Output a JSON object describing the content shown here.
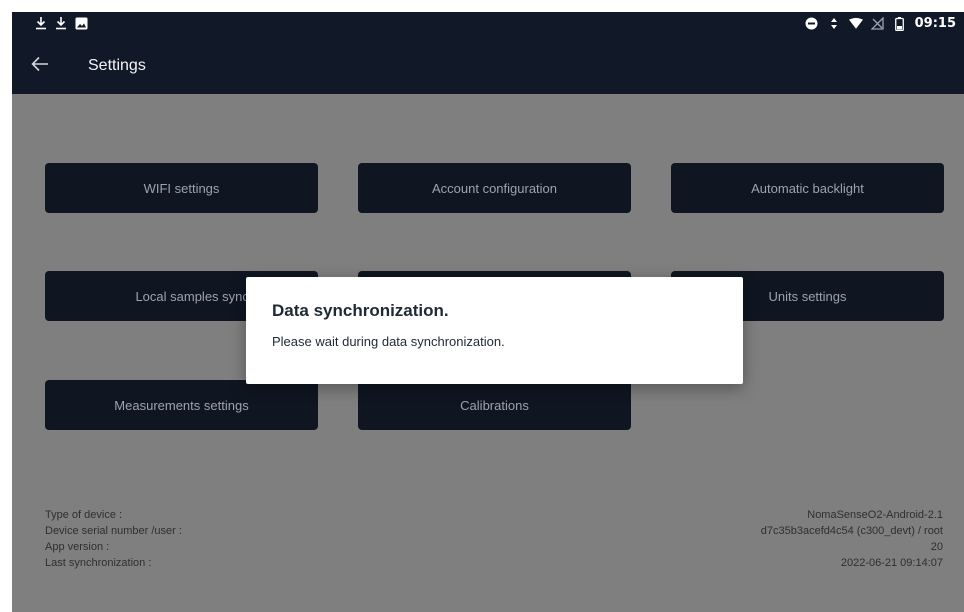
{
  "status_bar": {
    "left_icons": [
      "download-icon",
      "download-icon",
      "image-icon"
    ],
    "right_icons": [
      "do-not-disturb-icon",
      "data-arrows-icon",
      "wifi-icon",
      "no-signal-icon",
      "battery-icon"
    ],
    "time": "09:15"
  },
  "app_bar": {
    "title": "Settings",
    "back_icon": "arrow-left-icon"
  },
  "buttons": {
    "wifi": "WIFI settings",
    "account": "Account configuration",
    "backlight": "Automatic backlight",
    "local_sync": "Local samples synchronize",
    "units": "Units settings",
    "measurements": "Measurements settings",
    "calibrations": "Calibrations"
  },
  "device_info": [
    {
      "label": "Type of device :",
      "value": "NomaSenseO2-Android-2.1"
    },
    {
      "label": "Device serial number /user :",
      "value": "d7c35b3acefd4c54 (c300_devt) / root"
    },
    {
      "label": "App version :",
      "value": "20"
    },
    {
      "label": "Last synchronization :",
      "value": "2022-06-21 09:14:07"
    }
  ],
  "dialog": {
    "title": "Data synchronization.",
    "message": "Please wait during data synchronization."
  },
  "colors": {
    "bar_bg": "#111827",
    "button_bg": "#0f1621",
    "overlay_bg": "#7f7f7f",
    "dialog_bg": "#ffffff"
  }
}
